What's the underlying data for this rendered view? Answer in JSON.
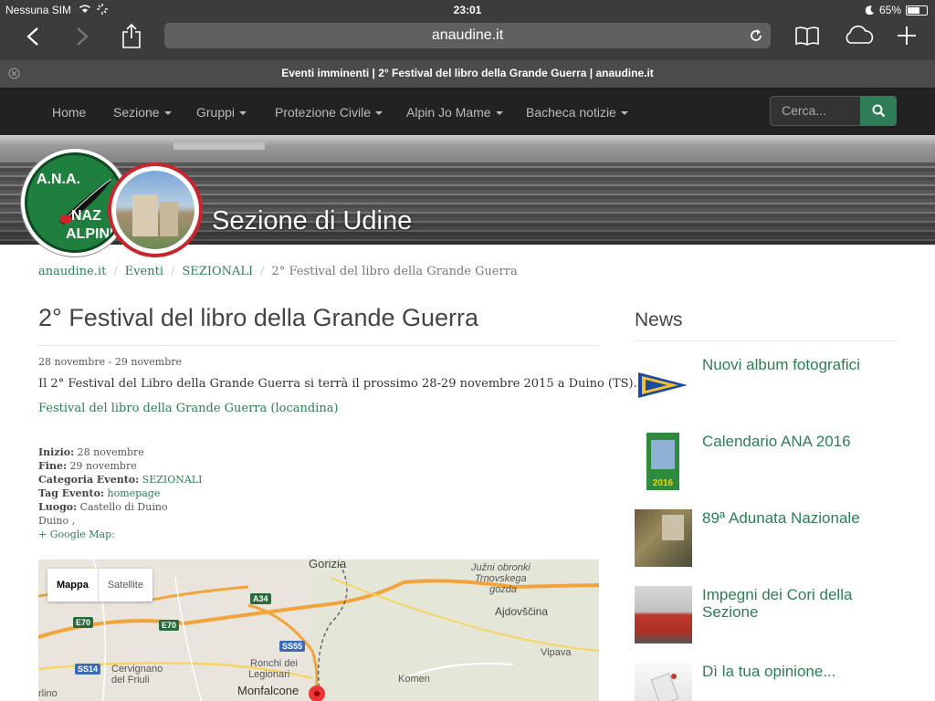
{
  "status": {
    "carrier": "Nessuna SIM",
    "time": "23:01",
    "battery": "65%",
    "battery_level": 0.65
  },
  "browser": {
    "url": "anaudine.it",
    "tab_title": "Eventi imminenti | 2° Festival del libro della Grande Guerra | anaudine.it"
  },
  "nav": {
    "items": [
      "Home",
      "Sezione",
      "Gruppi",
      "Protezione Civile",
      "Alpin Jo Mame",
      "Bacheca notizie"
    ],
    "search_placeholder": "Cerca..."
  },
  "site": {
    "title": "Sezione di Udine",
    "logo_text": [
      "A.N.A.",
      "NAZ",
      "ALPINI"
    ]
  },
  "breadcrumb": [
    "anaudine.it",
    "Eventi",
    "SEZIONALI",
    "2° Festival del libro della Grande Guerra"
  ],
  "event": {
    "title": "2° Festival del libro della Grande Guerra",
    "dates": "28 novembre - 29 novembre",
    "description": "Il 2° Festival del Libro della Grande Guerra si terrà il prossimo 28-29 novembre 2015 a Duino (TS).",
    "poster_link": "Festival del libro della Grande Guerra (locandina)",
    "details": {
      "start_label": "Inizio:",
      "start": "28 novembre",
      "end_label": "Fine:",
      "end": "29 novembre",
      "category_label": "Categoria Evento:",
      "category": "SEZIONALI",
      "tag_label": "Tag Evento:",
      "tag": "homepage",
      "place_label": "Luogo:",
      "place": "Castello di Duino",
      "place_line2": "Duino ,",
      "google_map": "+ Google Map:"
    }
  },
  "map": {
    "tab_map": "Mappa",
    "tab_satellite": "Satellite",
    "labels": [
      "Gorizia",
      "Južni obronki",
      "Trnovskega",
      "gozda",
      "Ajdovščina",
      "Vipava",
      "Komen",
      "Ronchi dei",
      "Legionari",
      "Monfalcone",
      "Cervignano",
      "del Friuli",
      "rlino"
    ],
    "roads": [
      "A34",
      "E70",
      "E70",
      "SS55",
      "SS14"
    ]
  },
  "news": {
    "heading": "News",
    "items": [
      {
        "title": "Nuovi album fotografici",
        "thumb": "flag-pennant-icon"
      },
      {
        "title": "Calendario ANA 2016",
        "thumb": "calendar-icon",
        "badge": "2016"
      },
      {
        "title": "89ª Adunata Nazionale",
        "thumb": "adunata-photo"
      },
      {
        "title": "Impegni dei Cori della Sezione",
        "thumb": "choir-photo"
      },
      {
        "title": "Dì la tua opinione...",
        "thumb": "opinion-photo"
      }
    ]
  },
  "colors": {
    "accent": "#2e7d57",
    "nav_bg": "#222222",
    "browser_chrome": "#3c3c3c",
    "logo_red": "#c8252d"
  }
}
